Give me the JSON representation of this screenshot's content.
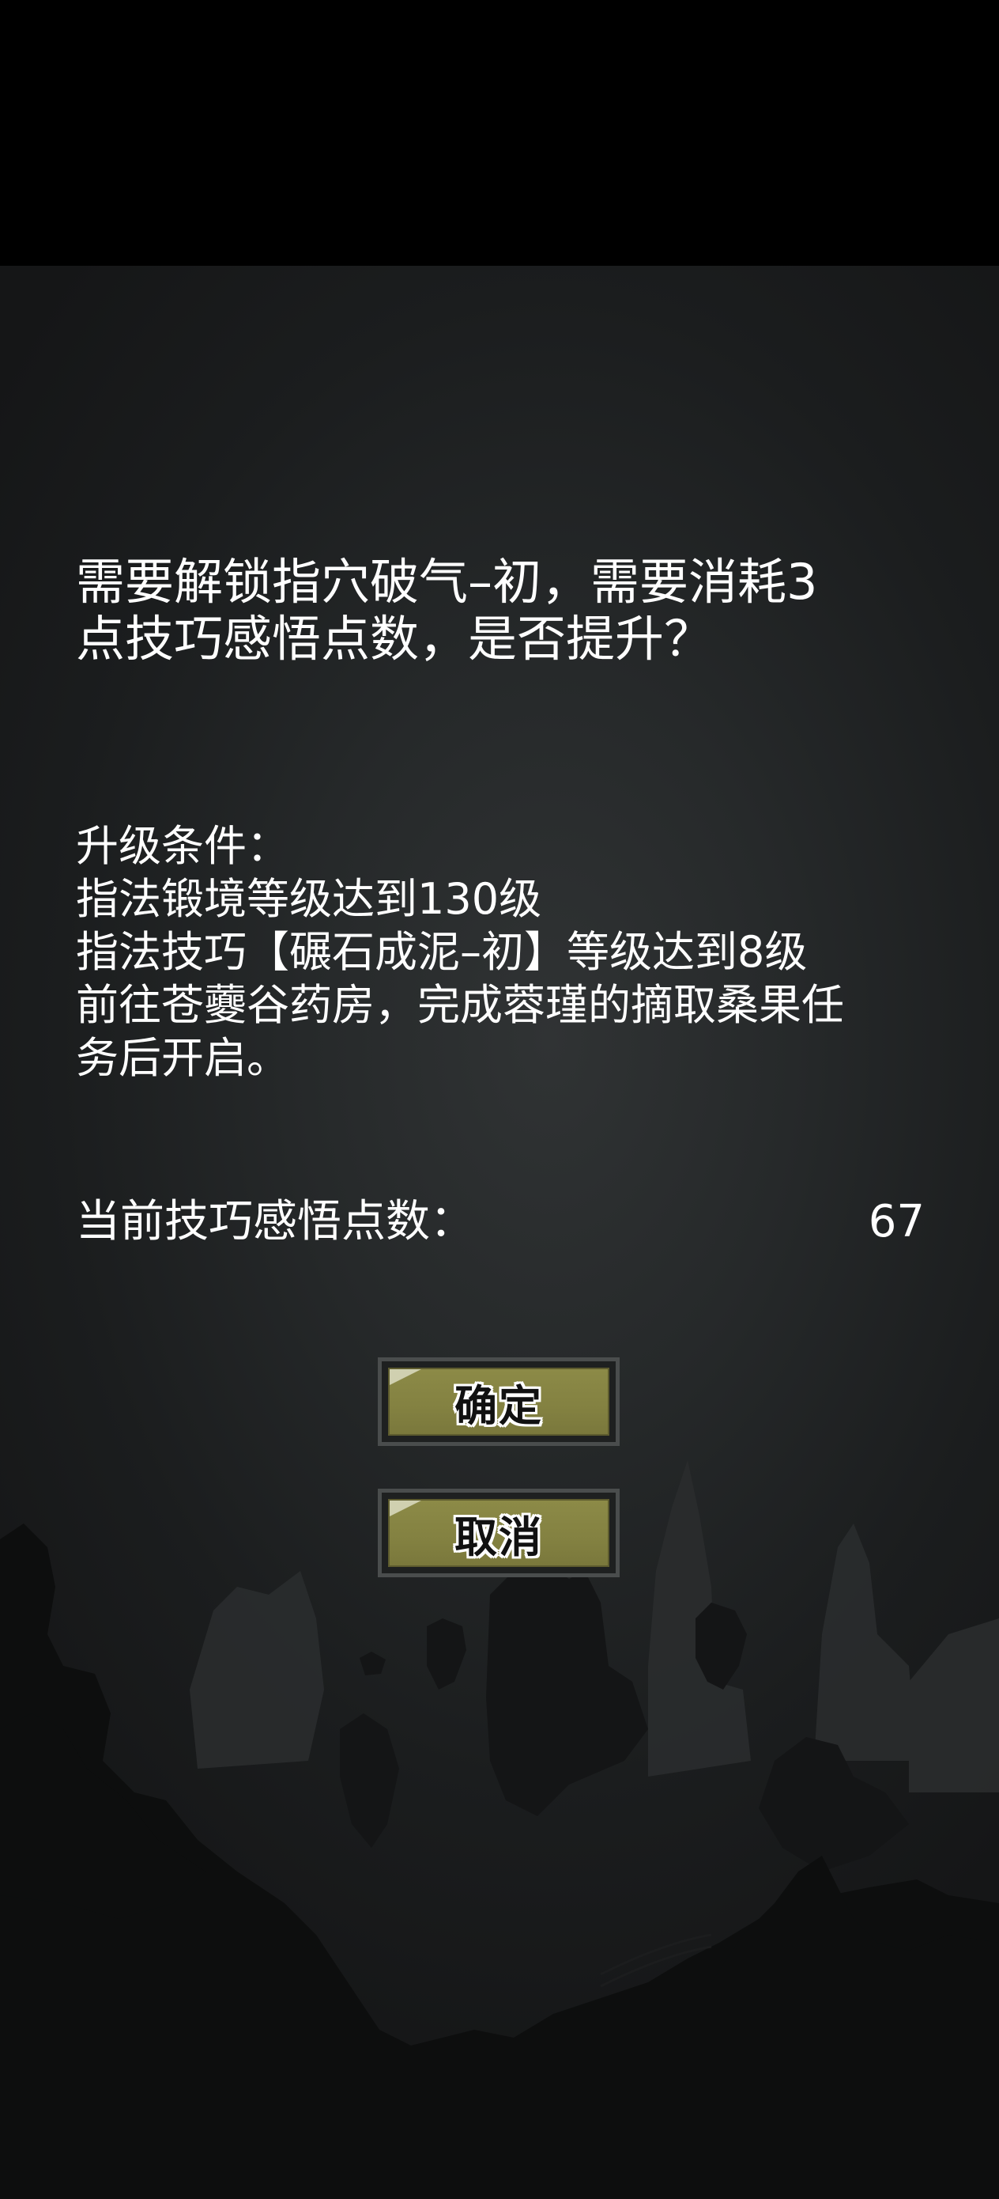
{
  "dialog": {
    "prompt_line1": "需要解锁指穴破气–初，需要消耗3",
    "prompt_line2": "点技巧感悟点数，是否提升？",
    "conditions": [
      "升级条件：",
      "指法锻境等级达到130级",
      "指法技巧【碾石成泥–初】等级达到8级",
      "前往苍虁谷药房，完成蓉瑾的摘取桑果任",
      "务后开启。"
    ],
    "current_points_label": "当前技巧感悟点数：",
    "current_points_value": "67"
  },
  "buttons": {
    "confirm_label": "确定",
    "cancel_label": "取消"
  },
  "colors": {
    "button_fill": "#8c8a47",
    "button_border": "#4a4d4d",
    "background": "#26292a"
  }
}
